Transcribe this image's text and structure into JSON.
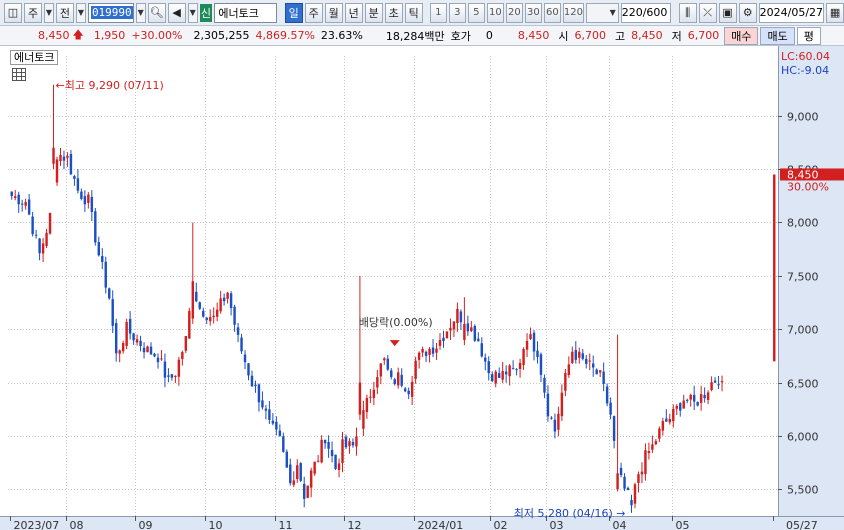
{
  "toolbar": {
    "period_main": "주",
    "prev": "전",
    "code": "019990",
    "name_badge": "신",
    "name": "에너토크",
    "periods": [
      "일",
      "주",
      "월",
      "년",
      "분",
      "초",
      "틱"
    ],
    "active_period": "일",
    "intervals": [
      "1",
      "3",
      "5",
      "10",
      "20",
      "30",
      "60",
      "120"
    ],
    "count": "220/600",
    "date": "2024/05/27"
  },
  "quote": {
    "price": "8,450",
    "change": "1,950",
    "change_pct": "+30.00%",
    "volume": "2,305,255",
    "vol_ratio": "4,869.57%",
    "turnover": "23.63%",
    "amount": "18,284백만",
    "hoga_label": "호가",
    "hoga_value": "0",
    "hoga_price": "8,450",
    "open_label": "시",
    "open": "6,700",
    "high_label": "고",
    "high": "8,450",
    "low_label": "저",
    "low": "6,700",
    "buy": "매수",
    "sell": "매도",
    "eval": "평"
  },
  "chart_label": "에너토크",
  "chart_data": {
    "type": "candlestick",
    "y_ticks": [
      "9,000",
      "8,500",
      "8,000",
      "7,500",
      "7,000",
      "6,500",
      "6,000",
      "5,500"
    ],
    "ylim": [
      5250,
      9560
    ],
    "x_ticks": [
      "2023/07",
      "08",
      "09",
      "10",
      "11",
      "12",
      "2024/01",
      "02",
      "03",
      "04",
      "05",
      "05/27"
    ],
    "last_price": "8,450",
    "last_pct": "30.00%",
    "lc_label": "LC:60.04",
    "hc_label": "HC:-9.04",
    "high_annotation": "최고 9,290 (07/11)",
    "low_annotation": "최저 5,280 (04/16)",
    "dividend_annotation": "배당락(0.00%)",
    "colors": {
      "up": "#d21f1f",
      "down": "#1b4fc4",
      "grid": "#c8c8c8"
    },
    "anchors": [
      [
        0,
        8250
      ],
      [
        4,
        8200
      ],
      [
        8,
        7700
      ],
      [
        11,
        8050
      ],
      [
        13,
        8650
      ],
      [
        16,
        8600
      ],
      [
        19,
        8300
      ],
      [
        22,
        8200
      ],
      [
        25,
        7700
      ],
      [
        28,
        7300
      ],
      [
        30,
        6750
      ],
      [
        33,
        7000
      ],
      [
        36,
        6900
      ],
      [
        39,
        6800
      ],
      [
        42,
        6750
      ],
      [
        45,
        6500
      ],
      [
        47,
        6600
      ],
      [
        50,
        6900
      ],
      [
        52,
        7400
      ],
      [
        54,
        7200
      ],
      [
        56,
        7150
      ],
      [
        58,
        7100
      ],
      [
        62,
        7350
      ],
      [
        65,
        6900
      ],
      [
        69,
        6500
      ],
      [
        72,
        6300
      ],
      [
        74,
        6100
      ],
      [
        77,
        5950
      ],
      [
        80,
        5550
      ],
      [
        82,
        5750
      ],
      [
        84,
        5450
      ],
      [
        86,
        5650
      ],
      [
        88,
        5800
      ],
      [
        90,
        6000
      ],
      [
        93,
        5700
      ],
      [
        95,
        5900
      ],
      [
        98,
        5900
      ],
      [
        101,
        6200
      ],
      [
        103,
        6400
      ],
      [
        105,
        6600
      ],
      [
        107,
        6700
      ],
      [
        109,
        6500
      ],
      [
        111,
        6550
      ],
      [
        114,
        6450
      ],
      [
        116,
        6700
      ],
      [
        119,
        6800
      ],
      [
        122,
        6850
      ],
      [
        125,
        7000
      ],
      [
        128,
        7150
      ],
      [
        131,
        7050
      ],
      [
        134,
        6900
      ],
      [
        137,
        6600
      ],
      [
        140,
        6550
      ],
      [
        142,
        6600
      ],
      [
        145,
        6600
      ],
      [
        148,
        6950
      ],
      [
        151,
        6800
      ],
      [
        154,
        6250
      ],
      [
        156,
        6050
      ],
      [
        158,
        6400
      ],
      [
        161,
        6800
      ],
      [
        164,
        6700
      ],
      [
        166,
        6650
      ],
      [
        169,
        6550
      ],
      [
        172,
        6200
      ],
      [
        174,
        5650
      ],
      [
        176,
        5500
      ],
      [
        178,
        5350
      ],
      [
        180,
        5650
      ],
      [
        182,
        5800
      ],
      [
        184,
        5900
      ],
      [
        187,
        6100
      ],
      [
        190,
        6200
      ],
      [
        193,
        6350
      ],
      [
        196,
        6300
      ],
      [
        199,
        6400
      ],
      [
        201,
        6500
      ],
      [
        203,
        6550
      ],
      [
        204,
        6450
      ]
    ]
  }
}
